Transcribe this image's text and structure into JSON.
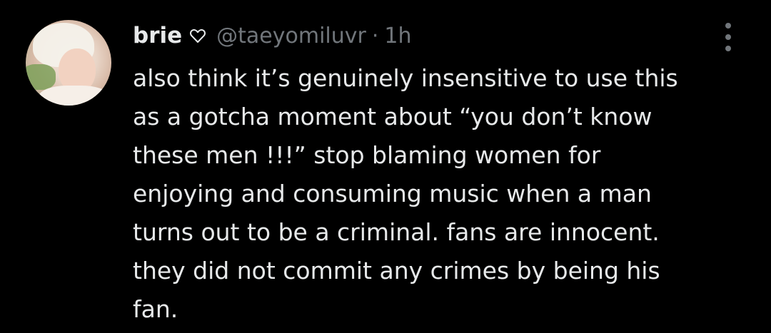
{
  "tweet": {
    "display_name": "brie",
    "name_badge_icon": "heart-outline-icon",
    "handle": "@taeyomiluvr",
    "separator": "·",
    "time": "1h",
    "more_icon": "more-vertical-icon",
    "text_lines": [
      "also think it’s genuinely insensitive to use this",
      "as a gotcha moment about “you don’t know",
      "these men !!!” stop blaming women for",
      "enjoying and consuming music when a man",
      "turns out to be a criminal. fans are innocent.",
      "they did not commit any crimes by being his",
      "fan."
    ]
  },
  "colors": {
    "background": "#000000",
    "primary_text": "#e7e9ea",
    "secondary_text": "#71767b"
  }
}
